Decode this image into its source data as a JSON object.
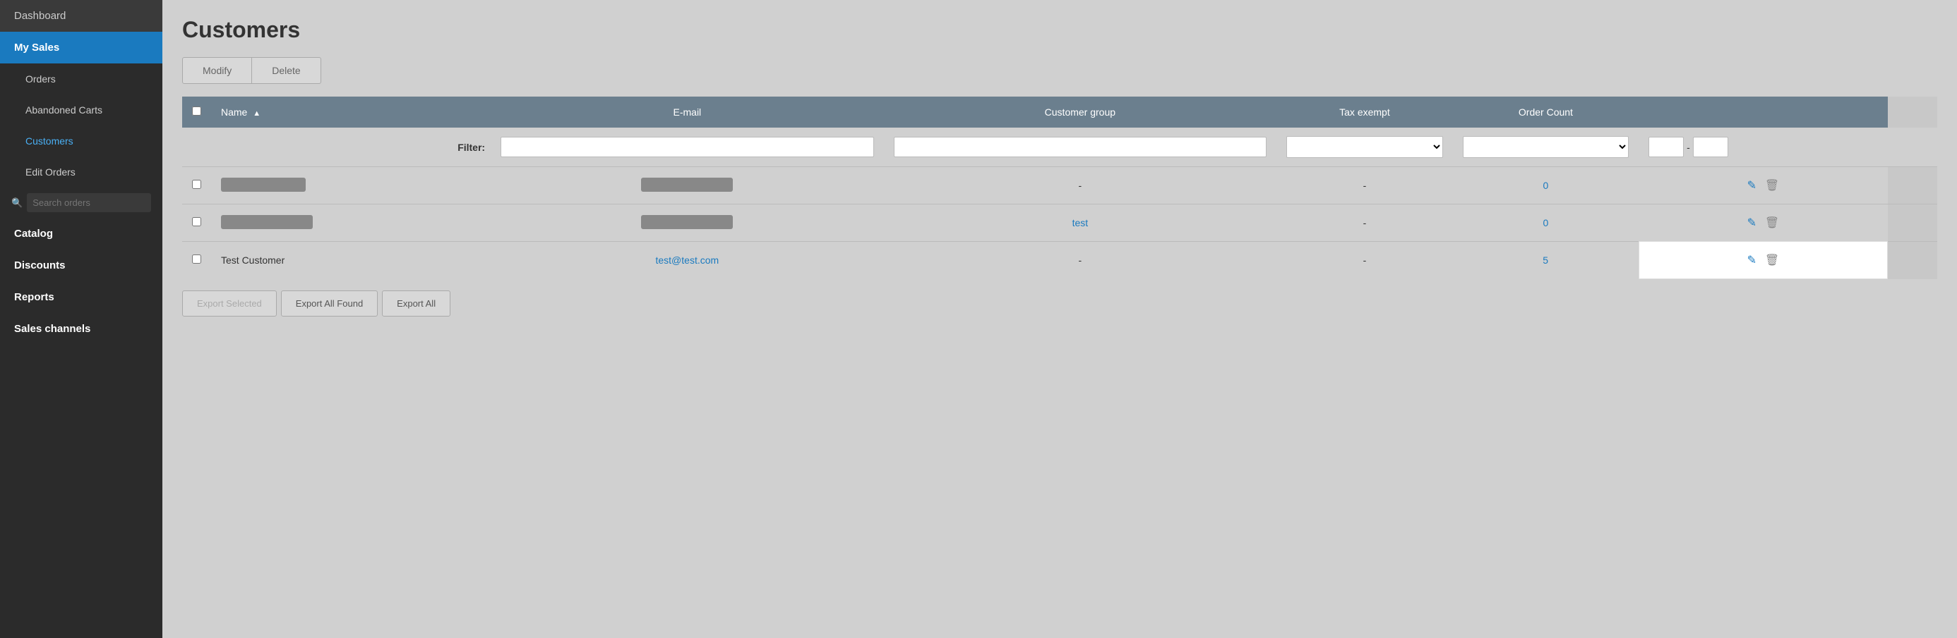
{
  "sidebar": {
    "items": [
      {
        "id": "dashboard",
        "label": "Dashboard",
        "type": "top",
        "active": false
      },
      {
        "id": "my-sales",
        "label": "My Sales",
        "type": "section",
        "active": true
      },
      {
        "id": "orders",
        "label": "Orders",
        "type": "sub",
        "active": false
      },
      {
        "id": "abandoned-carts",
        "label": "Abandoned Carts",
        "type": "sub",
        "active": false
      },
      {
        "id": "customers",
        "label": "Customers",
        "type": "sub",
        "active": true
      },
      {
        "id": "edit-orders",
        "label": "Edit Orders",
        "type": "sub",
        "active": false
      },
      {
        "id": "catalog",
        "label": "Catalog",
        "type": "top",
        "active": false
      },
      {
        "id": "discounts",
        "label": "Discounts",
        "type": "top",
        "active": false
      },
      {
        "id": "reports",
        "label": "Reports",
        "type": "top",
        "active": false
      },
      {
        "id": "sales-channels",
        "label": "Sales channels",
        "type": "top",
        "active": false
      }
    ],
    "search_placeholder": "Search orders"
  },
  "header": {
    "title": "Customers"
  },
  "action_buttons": {
    "modify": "Modify",
    "delete": "Delete"
  },
  "table": {
    "columns": [
      {
        "id": "checkbox",
        "label": ""
      },
      {
        "id": "name",
        "label": "Name",
        "sort": "asc"
      },
      {
        "id": "email",
        "label": "E-mail"
      },
      {
        "id": "customer-group",
        "label": "Customer group"
      },
      {
        "id": "tax-exempt",
        "label": "Tax exempt"
      },
      {
        "id": "order-count",
        "label": "Order Count"
      },
      {
        "id": "actions",
        "label": ""
      }
    ],
    "rows": [
      {
        "id": 1,
        "name": "",
        "name_placeholder": true,
        "name_width": 120,
        "email": "",
        "email_placeholder": true,
        "email_width": 130,
        "customer_group": "-",
        "tax_exempt": "-",
        "order_count": "0",
        "highlighted": false
      },
      {
        "id": 2,
        "name": "",
        "name_placeholder": true,
        "name_width": 130,
        "email": "",
        "email_placeholder": true,
        "email_width": 130,
        "customer_group": "test",
        "customer_group_link": true,
        "tax_exempt": "-",
        "order_count": "0",
        "highlighted": false
      },
      {
        "id": 3,
        "name": "Test Customer",
        "name_placeholder": false,
        "email": "test@test.com",
        "email_link": true,
        "customer_group": "-",
        "tax_exempt": "-",
        "order_count": "5",
        "order_count_link": true,
        "highlighted": true
      }
    ]
  },
  "export_buttons": {
    "export_selected": "Export Selected",
    "export_all_found": "Export All Found",
    "export_all": "Export All"
  }
}
